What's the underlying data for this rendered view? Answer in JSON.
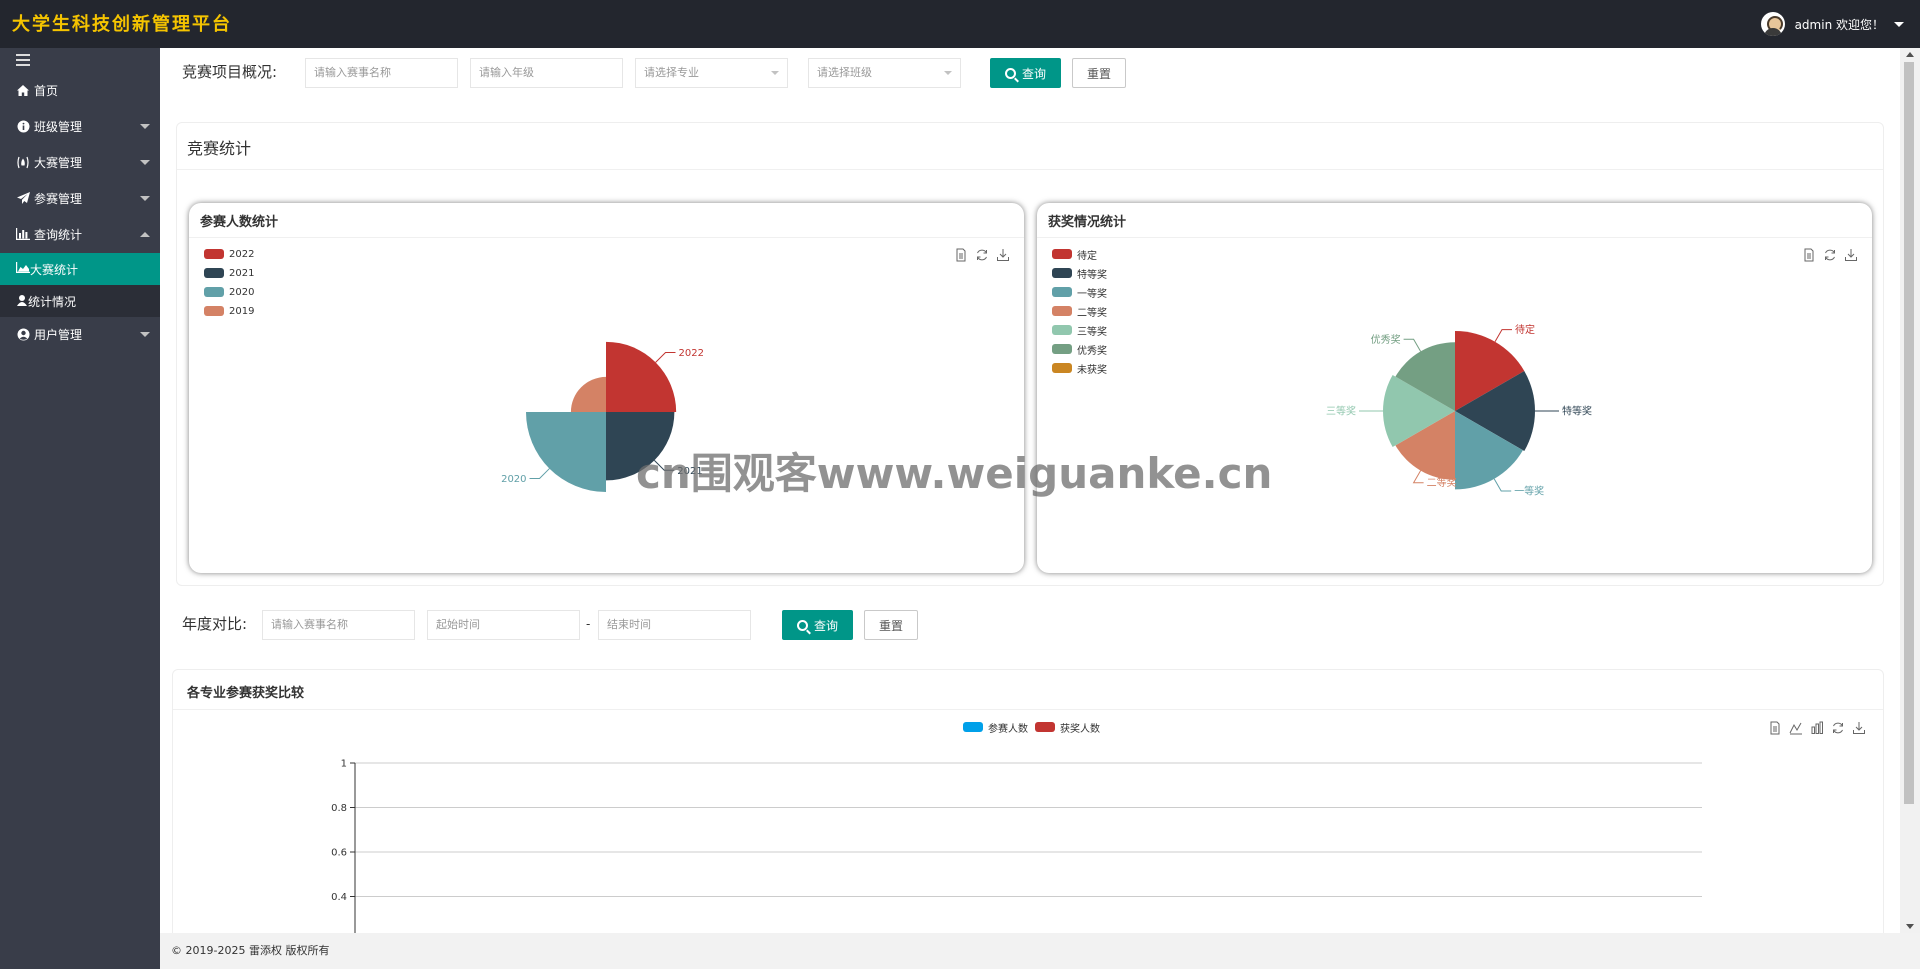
{
  "header": {
    "logo": "大学生科技创新管理平台",
    "user_label": "admin 欢迎您！"
  },
  "sidebar": {
    "items": [
      {
        "label": "首页",
        "icon": "home-icon"
      },
      {
        "label": "班级管理",
        "icon": "info-icon"
      },
      {
        "label": "大赛管理",
        "icon": "fire-icon"
      },
      {
        "label": "参赛管理",
        "icon": "paper-plane-icon"
      },
      {
        "label": "查询统计",
        "icon": "bar-chart-icon"
      },
      {
        "label": "大赛统计",
        "icon": "area-chart-icon"
      },
      {
        "label": "统计情况",
        "icon": "bank-icon"
      },
      {
        "label": "用户管理",
        "icon": "user-circle-icon"
      }
    ]
  },
  "overview": {
    "label": "竞赛项目概况:",
    "name_placeholder": "请输入赛事名称",
    "grade_placeholder": "请输入年级",
    "major_placeholder": "请选择专业",
    "class_placeholder": "请选择班级",
    "search_label": "查询",
    "reset_label": "重置"
  },
  "stats_card": {
    "title": "竞赛统计"
  },
  "participants_chart": {
    "title": "参赛人数统计",
    "legend": [
      "2022",
      "2021",
      "2020",
      "2019"
    ],
    "colors": [
      "#c23531",
      "#2f4554",
      "#61a0a8",
      "#d48265"
    ],
    "labels": [
      "2022",
      "2021",
      "2020"
    ]
  },
  "awards_chart": {
    "title": "获奖情况统计",
    "legend": [
      "待定",
      "特等奖",
      "一等奖",
      "二等奖",
      "三等奖",
      "优秀奖",
      "未获奖"
    ],
    "colors": [
      "#c23531",
      "#2f4554",
      "#61a0a8",
      "#d48265",
      "#91c7ae",
      "#749f83",
      "#ca8622"
    ],
    "labels": [
      "待定",
      "特等奖",
      "一等奖",
      "二等奖",
      "三等奖",
      "优秀奖"
    ]
  },
  "yearly": {
    "label": "年度对比:",
    "name_placeholder": "请输入赛事名称",
    "start_placeholder": "起始时间",
    "separator": "-",
    "end_placeholder": "结束时间",
    "search_label": "查询",
    "reset_label": "重置"
  },
  "compare_card": {
    "title": "各专业参赛获奖比较"
  },
  "chart_data": [
    {
      "type": "pie",
      "title": "参赛人数统计",
      "labels": [
        "2022",
        "2021",
        "2020",
        "2019"
      ],
      "values": [
        2,
        1.9,
        2.6,
        0.5
      ]
    },
    {
      "type": "pie",
      "title": "获奖情况统计",
      "labels": [
        "待定",
        "特等奖",
        "一等奖",
        "二等奖",
        "三等奖",
        "优秀奖",
        "未获奖"
      ],
      "values": [
        1,
        1,
        1,
        1,
        1,
        1,
        0
      ]
    },
    {
      "type": "bar",
      "title": "各专业参赛获奖比较",
      "series": [
        {
          "name": "参赛人数",
          "values": []
        },
        {
          "name": "获奖人数",
          "values": []
        }
      ],
      "series_colors": [
        "#00a0e9",
        "#c23531"
      ],
      "ylim": [
        0,
        1
      ],
      "yticks": [
        "1",
        "0.8",
        "0.6",
        "0.4"
      ]
    }
  ],
  "footer": {
    "text": "© 2019-2025 雷添权 版权所有"
  },
  "watermark": "cn围观客www.weiguanke.cn"
}
